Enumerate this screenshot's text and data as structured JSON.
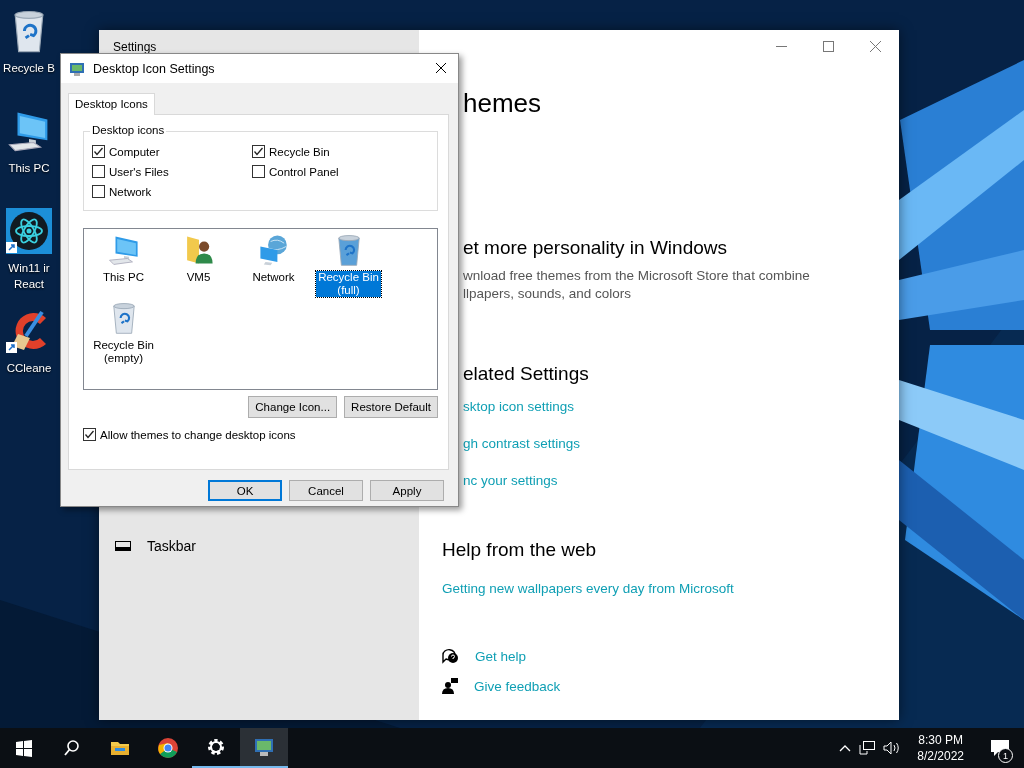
{
  "desktop_icons": [
    {
      "kind": "bin",
      "lines": [
        "Recycle B"
      ]
    },
    {
      "kind": "pc",
      "lines": [
        "This PC"
      ]
    },
    {
      "kind": "react",
      "lines": [
        "Win11 ir",
        "React"
      ]
    },
    {
      "kind": "cleaner",
      "lines": [
        "CCleane"
      ]
    }
  ],
  "settings_window": {
    "title": "Settings",
    "nav_items": [
      {
        "label": "Taskbar"
      }
    ],
    "covered_part": {
      "page_heading": "hemes",
      "personality": {
        "heading": "et more personality in Windows",
        "lines": [
          "wnload free themes from the Microsoft Store that combine",
          "llpapers, sounds, and colors"
        ]
      },
      "related": {
        "heading": "elated Settings",
        "links": [
          "sktop icon settings",
          "gh contrast settings",
          "nc your settings"
        ]
      }
    },
    "help": {
      "heading": "Help from the web",
      "links": [
        "Getting new wallpapers every day from Microsoft"
      ]
    },
    "support_links": [
      {
        "kind": "help",
        "label": "Get help"
      },
      {
        "kind": "feedback",
        "label": "Give feedback"
      }
    ]
  },
  "dialog": {
    "title": "Desktop Icon Settings",
    "tabs": [
      {
        "label": "Desktop Icons",
        "selected": true
      }
    ],
    "group": {
      "legend": "Desktop icons",
      "checkboxes": [
        {
          "label": "Computer",
          "checked": true
        },
        {
          "label": "Recycle Bin",
          "checked": true
        },
        {
          "label": "User's Files",
          "checked": false
        },
        {
          "label": "Control Panel",
          "checked": false
        },
        {
          "label": "Network",
          "checked": false
        }
      ]
    },
    "icons": [
      {
        "kind": "pc",
        "lines": [
          "This PC"
        ],
        "selected": false
      },
      {
        "kind": "user",
        "lines": [
          "VM5"
        ],
        "selected": false
      },
      {
        "kind": "network",
        "lines": [
          "Network"
        ],
        "selected": false
      },
      {
        "kind": "bin-full",
        "lines": [
          "Recycle Bin",
          "(full)"
        ],
        "selected": true
      },
      {
        "kind": "bin-empty",
        "lines": [
          "Recycle Bin",
          "(empty)"
        ],
        "selected": false
      }
    ],
    "icon_buttons": [
      "Change Icon...",
      "Restore Default"
    ],
    "allow_themes": {
      "label": "Allow themes to change desktop icons",
      "checked": true
    },
    "buttons": [
      {
        "label": "OK",
        "default": true
      },
      {
        "label": "Cancel",
        "default": false
      },
      {
        "label": "Apply",
        "default": false
      }
    ]
  },
  "taskbar": {
    "apps": [
      {
        "kind": "start",
        "open": false,
        "selected": false
      },
      {
        "kind": "search",
        "open": false,
        "selected": false
      },
      {
        "kind": "explorer",
        "open": false,
        "selected": false
      },
      {
        "kind": "chrome",
        "open": false,
        "selected": false
      },
      {
        "kind": "settings",
        "open": true,
        "selected": false
      },
      {
        "kind": "display",
        "open": true,
        "selected": true
      }
    ],
    "time": "8:30 PM",
    "date": "8/2/2022",
    "notification_count": "1"
  }
}
